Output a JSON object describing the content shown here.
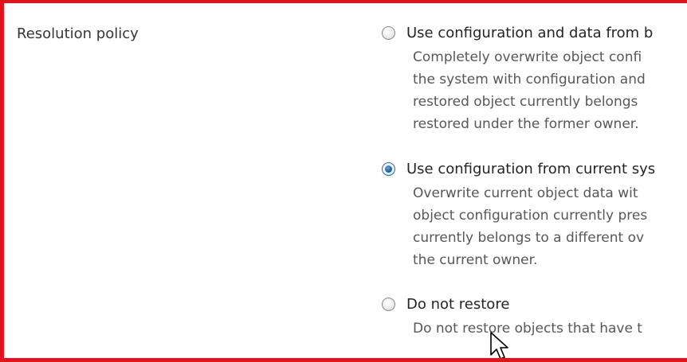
{
  "section": {
    "label": "Resolution policy"
  },
  "options": [
    {
      "label": "Use configuration and data from b",
      "selected": false,
      "description_lines": [
        "Completely overwrite object confi",
        "the system with configuration and",
        "restored object currently belongs",
        "restored under the former owner."
      ]
    },
    {
      "label": "Use configuration from current sys",
      "selected": true,
      "description_lines": [
        "Overwrite current object data wit",
        "object configuration currently pres",
        "currently belongs to a different ov",
        "the current owner."
      ]
    },
    {
      "label": "Do not restore",
      "selected": false,
      "description_lines": [
        "Do not restore objects that have t"
      ]
    }
  ],
  "colors": {
    "frame_border": "#e1141b",
    "selected_radio": "#1f5c94"
  },
  "icons": {
    "cursor": "arrow-cursor-icon"
  }
}
